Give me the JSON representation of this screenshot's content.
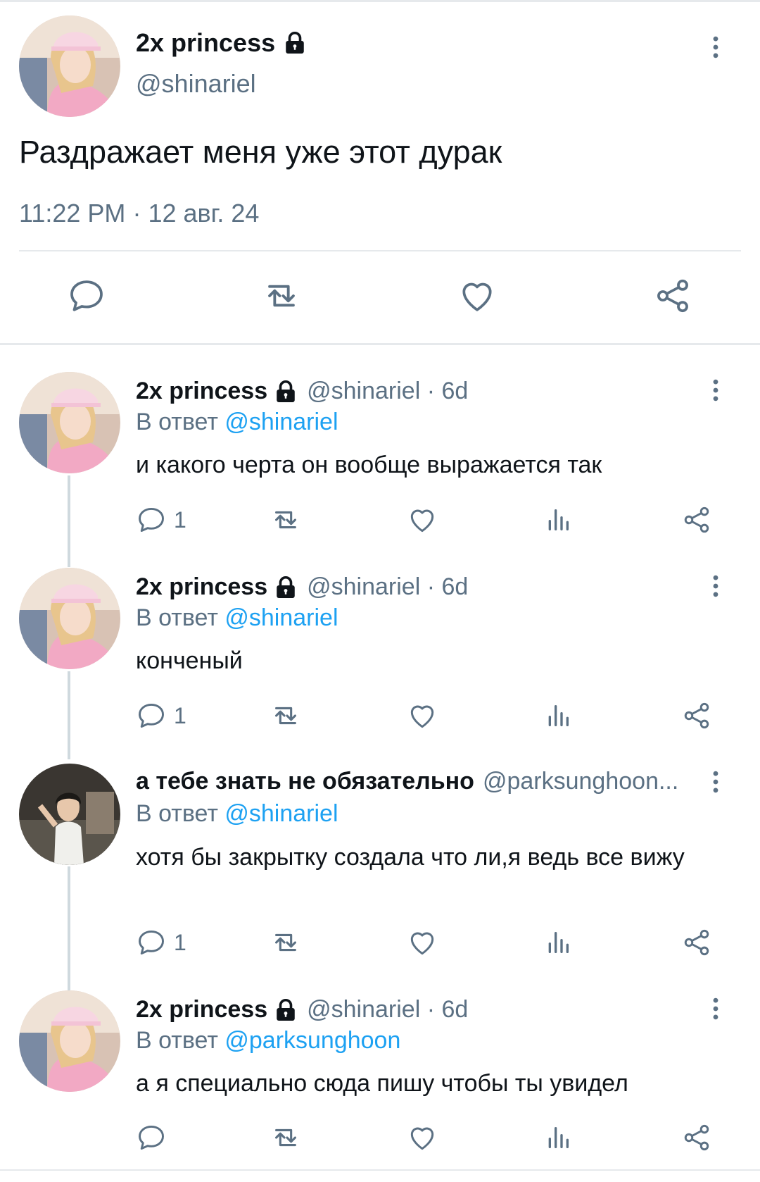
{
  "main_tweet": {
    "display_name": "2x princess",
    "handle": "@shinariel",
    "text": "Раздражает меня уже этот дурак",
    "time": "11:22 PM",
    "date_sep": "·",
    "date": "12 авг. 24"
  },
  "replies": [
    {
      "display_name": "2x princess",
      "handle": "@shinariel · 6d",
      "reply_prefix": "В ответ",
      "reply_to": "@shinariel",
      "text": "и какого черта он вообще выражается так",
      "reply_count": "1"
    },
    {
      "display_name": "2x princess",
      "handle": "@shinariel · 6d",
      "reply_prefix": "В ответ",
      "reply_to": "@shinariel",
      "text": "конченый",
      "reply_count": "1"
    },
    {
      "display_name": "а тебе знать не обязательно",
      "handle": "@parksunghoon...",
      "reply_prefix": "В ответ",
      "reply_to": "@shinariel",
      "text": "хотя бы закрытку создала что ли,я ведь все вижу",
      "reply_count": "1"
    },
    {
      "display_name": "2x princess",
      "handle": "@shinariel · 6d",
      "reply_prefix": "В ответ",
      "reply_to": "@parksunghoon",
      "text": "а я специально сюда пишу чтобы ты увидел",
      "reply_count": ""
    }
  ],
  "colors": {
    "text": "#0f1419",
    "secondary": "#5b7083",
    "link": "#1da1f2",
    "divider": "#e6e9ec"
  },
  "icons": {
    "lock": "lock-icon",
    "more": "more-vertical-icon",
    "reply": "reply-icon",
    "retweet": "retweet-icon",
    "like": "heart-icon",
    "views": "views-icon",
    "share": "share-icon"
  }
}
